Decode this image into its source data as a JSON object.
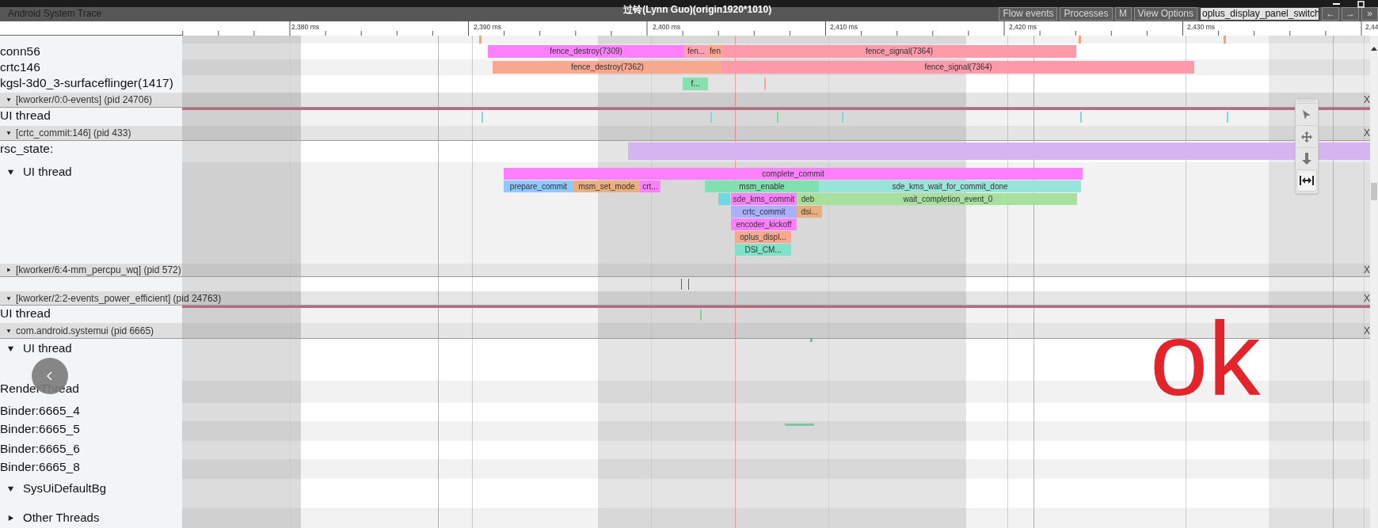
{
  "window": {
    "app_name": "Android System Trace",
    "title": "过铃(Lynn Guo)(origin1920*1010)"
  },
  "toolbar": [
    {
      "label": "Flow events",
      "kind": "button"
    },
    {
      "label": "Processes",
      "kind": "button"
    },
    {
      "label": "M",
      "kind": "button"
    },
    {
      "label": "View Options",
      "kind": "button"
    },
    {
      "label": "oplus_display_panel_switch",
      "kind": "selector"
    },
    {
      "label": "←",
      "kind": "button"
    },
    {
      "label": "→",
      "kind": "button"
    },
    {
      "label": "»",
      "kind": "button"
    }
  ],
  "ruler": {
    "ticks": [
      "2,380 ms",
      "2,390 ms",
      "2,400 ms",
      "2,410 ms",
      "2,420 ms",
      "2,430 ms",
      "2,44"
    ]
  },
  "tracks": [
    {
      "kind": "thread",
      "slices": [
        {
          "color": "#f8a070"
        },
        {
          "color": "#f8a070"
        },
        {
          "color": "#f8a070"
        }
      ]
    },
    {
      "kind": "thread",
      "name": "conn56",
      "slices": [
        {
          "name": "fence_destroy(7309)",
          "color": "#ff80ff"
        },
        {
          "name": "fen...",
          "color": "#ffa3b4"
        },
        {
          "name": "fen",
          "color": "#f8a98e"
        },
        {
          "name": "fence_signal(7364)",
          "color": "#ff9aaa"
        }
      ]
    },
    {
      "kind": "thread",
      "name": "crtc146",
      "slices": [
        {
          "name": "fence_destroy(7362)",
          "color": "#f9a890"
        },
        {
          "name": "fence_signal(7364)",
          "color": "#ff9aaa"
        }
      ]
    },
    {
      "kind": "thread",
      "name": "kgsl-3d0_3-surfaceflinger(1417)",
      "slices": [
        {
          "name": "f...",
          "color": "#88e0b0"
        },
        {
          "color": "#f8a890"
        }
      ]
    },
    {
      "kind": "process",
      "label": "[kworker/0:0-events] (pid 24706)",
      "expanded": true,
      "close": "X"
    },
    {
      "kind": "thread",
      "name": "UI thread",
      "busy": true,
      "slices": [
        {
          "color": "#80d8d8"
        },
        {
          "color": "#80d8d8"
        },
        {
          "color": "#80d8a0"
        },
        {
          "color": "#80d8d8"
        },
        {
          "color": "#80d8d8"
        },
        {
          "color": "#80d8d8"
        }
      ]
    },
    {
      "kind": "process",
      "label": "[crtc_commit:146] (pid 433)",
      "expanded": true,
      "close": "X"
    },
    {
      "kind": "thread",
      "name": "rsc_state:",
      "slices": [
        {
          "color": "#d6b4f2"
        }
      ]
    },
    {
      "kind": "thread",
      "name": "UI thread",
      "expanded": true,
      "slices": [
        {
          "name": "complete_commit",
          "color": "#ff80ff"
        },
        {
          "name": "prepare_commit",
          "color": "#90c8ff"
        },
        {
          "name": "msm_set_mode",
          "color": "#e8b080"
        },
        {
          "name": "crt...",
          "color": "#ff80ff"
        },
        {
          "name": "msm_enable",
          "color": "#80e0b0"
        },
        {
          "name": "sde_kms_wait_for_commit_done",
          "color": "#98e4d8"
        },
        {
          "color": "#70d8e0"
        },
        {
          "name": "sde_kms_commit",
          "color": "#ff80ff"
        },
        {
          "name": "deb",
          "color": "#a8e098"
        },
        {
          "name": "wait_completion_event_0",
          "color": "#a8e0a0"
        },
        {
          "name": "crtc_commit",
          "color": "#a8b0ff"
        },
        {
          "name": "dsi...",
          "color": "#e8b080"
        },
        {
          "name": "encoder_kickoff",
          "color": "#ff80ff"
        },
        {
          "name": "oplus_displ...",
          "color": "#f8a890"
        },
        {
          "name": "DSI_CM...",
          "color": "#80e0c8"
        }
      ]
    },
    {
      "kind": "process",
      "label": "[kworker/6:4-mm_percpu_wq] (pid 572)",
      "expanded": false,
      "close": "X"
    },
    {
      "kind": "thread",
      "slices": [
        {
          "color": "#606060"
        },
        {
          "color": "#606060"
        }
      ]
    },
    {
      "kind": "process",
      "label": "[kworker/2:2-events_power_efficient] (pid 24763)",
      "expanded": true,
      "close": "X"
    },
    {
      "kind": "thread",
      "name": "UI thread",
      "busy": true,
      "slices": [
        {
          "color": "#80d0a0"
        }
      ]
    },
    {
      "kind": "process",
      "label": "com.android.systemui (pid 6665)",
      "expanded": true,
      "close": "X"
    },
    {
      "kind": "thread",
      "name": "UI thread",
      "expanded": true,
      "slices": [
        {
          "color": "#60c0b0"
        }
      ]
    },
    {
      "kind": "thread",
      "name": "RenderThread"
    },
    {
      "kind": "thread",
      "name": "Binder:6665_4"
    },
    {
      "kind": "thread",
      "name": "Binder:6665_5",
      "slices": [
        {
          "color": "#80c8a0"
        }
      ]
    },
    {
      "kind": "thread",
      "name": "Binder:6665_6"
    },
    {
      "kind": "thread",
      "name": "Binder:6665_8"
    },
    {
      "kind": "thread",
      "name": "SysUiDefaultBg",
      "expanded": true
    },
    {
      "kind": "thread",
      "name": "Other Threads",
      "expanded": false
    }
  ],
  "tools": [
    {
      "kind": "pointer",
      "selected": false
    },
    {
      "kind": "pan",
      "selected": false
    },
    {
      "kind": "zoom",
      "selected": false
    },
    {
      "kind": "fit",
      "selected": true
    }
  ],
  "annotation": "ok"
}
